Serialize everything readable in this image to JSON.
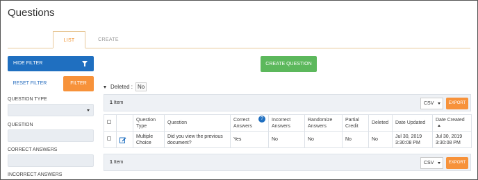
{
  "page": {
    "title": "Questions"
  },
  "tabs": [
    {
      "label": "LIST",
      "active": true
    },
    {
      "label": "CREATE",
      "active": false
    }
  ],
  "filter_panel": {
    "hide_filter_label": "HIDE FILTER",
    "reset_filter_label": "RESET FILTER",
    "filter_label": "FILTER",
    "fields": [
      {
        "label": "QUESTION TYPE",
        "type": "select",
        "value": ""
      },
      {
        "label": "QUESTION",
        "type": "text",
        "value": ""
      },
      {
        "label": "CORRECT ANSWERS",
        "type": "text",
        "value": ""
      },
      {
        "label": "INCORRECT ANSWERS",
        "type": "text",
        "value": ""
      }
    ]
  },
  "toolbar": {
    "create_question_label": "CREATE QUESTION"
  },
  "deleted_filter": {
    "label": "Deleted :",
    "value": "No"
  },
  "results": {
    "count": "1",
    "count_suffix": "Item",
    "export_format": "CSV",
    "export_label": "EXPORT"
  },
  "table": {
    "headers": [
      "",
      "",
      "Question Type",
      "Question",
      "Correct Answers",
      "Incorrect Answers",
      "Randomize Answers",
      "Partial Credit",
      "Deleted",
      "Date Updated",
      "Date Created"
    ],
    "help_glyph": "?",
    "rows": [
      {
        "question_type": "Multiple Choice",
        "question": "Did you view the previous document?",
        "correct_answers": "Yes",
        "incorrect_answers": "No",
        "randomize_answers": "No",
        "partial_credit": "No",
        "deleted": "No",
        "date_updated": "Jul 30, 2019 3:30:08 PM",
        "date_created": "Jul 30, 2019 3:30:08 PM"
      }
    ]
  },
  "colors": {
    "primary": "#1f6fc0",
    "accent_orange": "#f7923a",
    "success_green": "#5cb85c"
  }
}
